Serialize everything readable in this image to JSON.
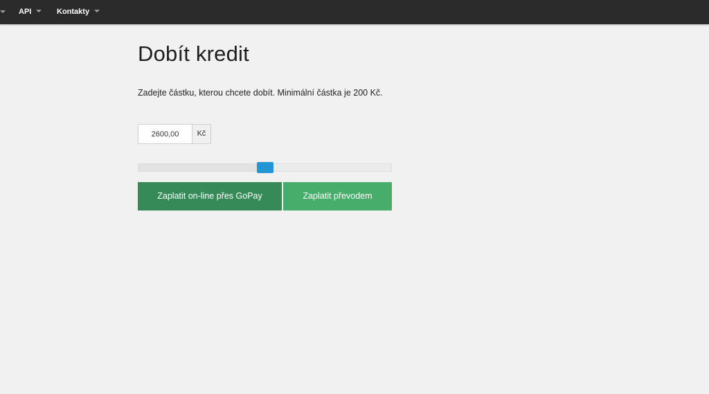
{
  "nav": {
    "items": [
      {
        "label": "API"
      },
      {
        "label": "Kontakty"
      }
    ]
  },
  "main": {
    "title": "Dobít kredit",
    "intro": "Zadejte částku, kterou chcete dobít. Minimální částka je 200 Kč.",
    "amount": {
      "value": "2600,00",
      "currency": "Kč"
    },
    "slider": {
      "level_percent": 50
    },
    "buttons": {
      "gopay": "Zaplatit on-line přes GoPay",
      "transfer": "Zaplatit převodem"
    }
  },
  "colors": {
    "topbar": "#2b2b2b",
    "slider_handle": "#2196d3",
    "button_gopay": "#368a57",
    "button_transfer": "#46ad6a"
  }
}
